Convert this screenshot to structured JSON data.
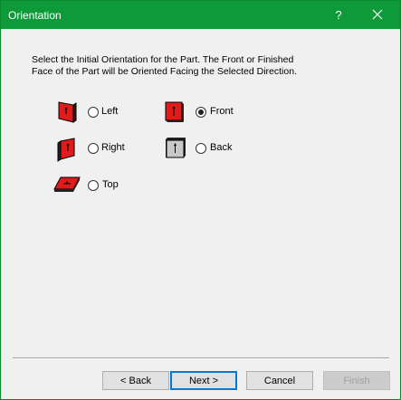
{
  "window": {
    "title": "Orientation",
    "help_glyph": "?",
    "close_icon": "close-icon"
  },
  "instructions": "Select the Initial Orientation for the Part.  The Front or Finished Face of the Part will be Oriented Facing the Selected Direction.",
  "options": {
    "left": {
      "label": "Left",
      "checked": false
    },
    "front": {
      "label": "Front",
      "checked": true
    },
    "right": {
      "label": "Right",
      "checked": false
    },
    "back": {
      "label": "Back",
      "checked": false
    },
    "top": {
      "label": "Top",
      "checked": false
    }
  },
  "buttons": {
    "back": "< Back",
    "next": "Next >",
    "cancel": "Cancel",
    "finish": "Finish"
  },
  "colors": {
    "titlebar": "#0f9a3a",
    "part_red": "#e11b1b",
    "part_gray": "#c8c8c8"
  }
}
